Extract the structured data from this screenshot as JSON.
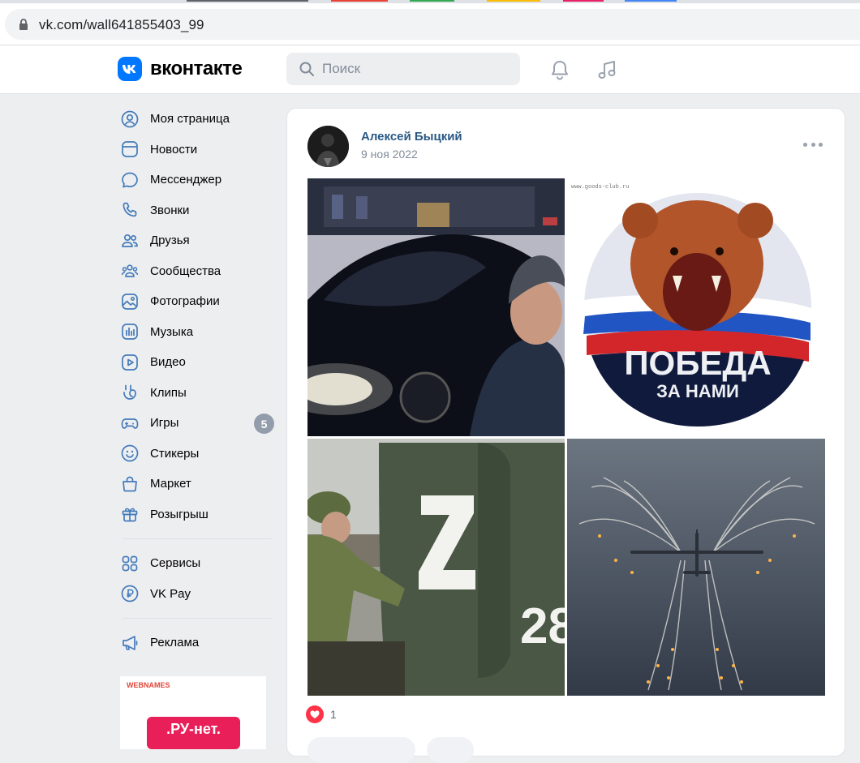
{
  "browser": {
    "url": "vk.com/wall641855403_99"
  },
  "header": {
    "logo_text": "вконтакте",
    "search_placeholder": "Поиск"
  },
  "sidebar": {
    "items": [
      {
        "label": "Моя страница",
        "icon": "user-circle-icon"
      },
      {
        "label": "Новости",
        "icon": "newsfeed-icon"
      },
      {
        "label": "Мессенджер",
        "icon": "message-icon"
      },
      {
        "label": "Звонки",
        "icon": "phone-icon"
      },
      {
        "label": "Друзья",
        "icon": "friends-icon"
      },
      {
        "label": "Сообщества",
        "icon": "communities-icon"
      },
      {
        "label": "Фотографии",
        "icon": "photo-icon"
      },
      {
        "label": "Музыка",
        "icon": "music-icon"
      },
      {
        "label": "Видео",
        "icon": "video-icon"
      },
      {
        "label": "Клипы",
        "icon": "clips-icon"
      },
      {
        "label": "Игры",
        "icon": "games-icon",
        "badge": "5"
      },
      {
        "label": "Стикеры",
        "icon": "smile-icon"
      },
      {
        "label": "Маркет",
        "icon": "market-icon"
      },
      {
        "label": "Розыгрыш",
        "icon": "gift-icon"
      }
    ],
    "services": [
      {
        "label": "Сервисы",
        "icon": "services-icon"
      },
      {
        "label": "VK Pay",
        "icon": "vkpay-icon"
      }
    ],
    "ads_label": "Реклама",
    "ad_banner": {
      "brand": "WEBNAMES",
      "headline": ".РУ-нет."
    }
  },
  "post": {
    "author": "Алексей Быцкий",
    "date": "9 ноя 2022",
    "photo2_caption_line1": "ПОБЕДА",
    "photo2_caption_line2": "ЗА НАМИ",
    "photo2_watermark": "www.goods-club.ru",
    "photo3_marking": "Z",
    "photo3_number": "28",
    "likes": "1"
  },
  "colors": {
    "brand": "#0077ff",
    "link": "#2a5885",
    "like": "#ff3347",
    "bg": "#edeef0"
  }
}
